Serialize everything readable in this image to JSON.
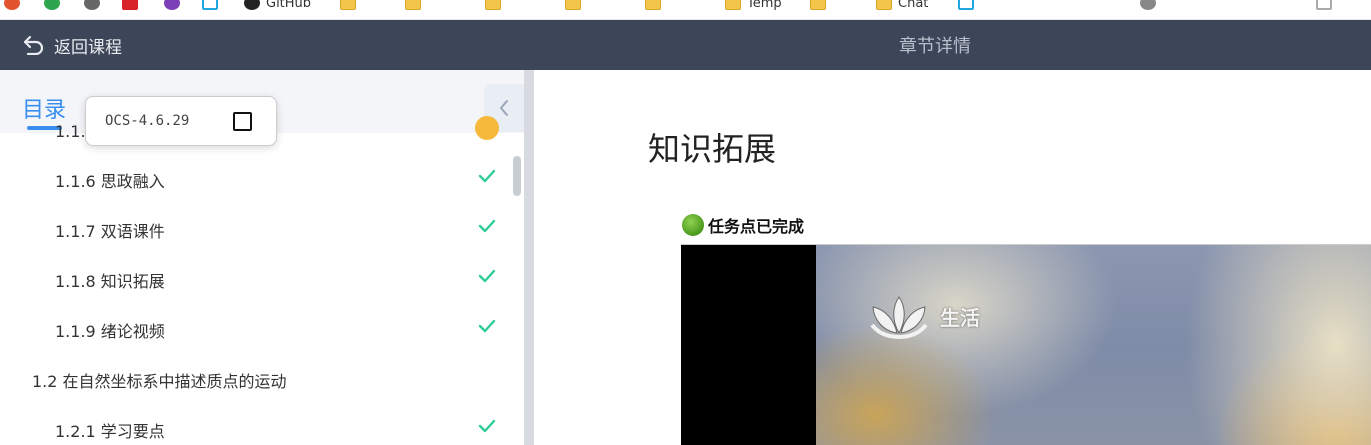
{
  "bookmarks": [
    "GitHub",
    "Temp",
    "Chat"
  ],
  "header": {
    "back_label": "返回课程",
    "title": "章节详情"
  },
  "sidebar": {
    "title": "目录",
    "items": [
      {
        "label": "1.1.5 练习与自测",
        "status": "warning"
      },
      {
        "label": "1.1.6 思政融入",
        "status": "done"
      },
      {
        "label": "1.1.7 双语课件",
        "status": "done"
      },
      {
        "label": "1.1.8 知识拓展",
        "status": "done"
      },
      {
        "label": "1.1.9 绪论视频",
        "status": "done"
      },
      {
        "label": "1.2 在自然坐标系中描述质点的运动",
        "status": "none"
      },
      {
        "label": "1.2.1 学习要点",
        "status": "done"
      }
    ]
  },
  "popup": {
    "version": "OCS-4.6.29"
  },
  "main": {
    "title": "知识拓展",
    "task_status": "任务点已完成",
    "video_logo_text": "生活"
  },
  "colors": {
    "header_bg": "#3d4659",
    "accent": "#3a8ef0",
    "check": "#2ecc9a",
    "warning": "#f6b93b"
  }
}
